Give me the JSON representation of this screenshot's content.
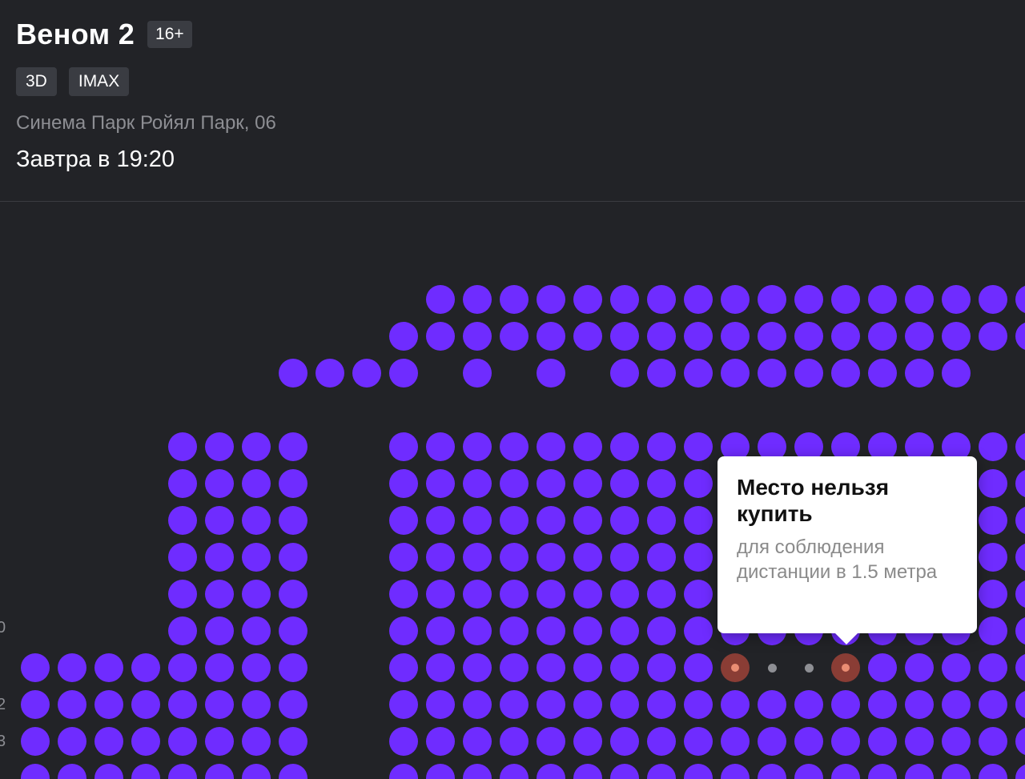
{
  "movie": {
    "title": "Веном 2",
    "age_rating": "16+",
    "formats": [
      "3D",
      "IMAX"
    ],
    "cinema": "Синема Парк Ройял Парк, 06",
    "datetime": "Завтра в 19:20"
  },
  "tooltip": {
    "title": "Место нельзя купить",
    "description": "для соблюдения дистанции в 1.5 метра"
  },
  "row_numbers": [
    "0",
    "2",
    "3"
  ],
  "colors": {
    "seat_available": "#6f2cff",
    "seat_blocked": "#8a3d35",
    "background": "#222327"
  }
}
